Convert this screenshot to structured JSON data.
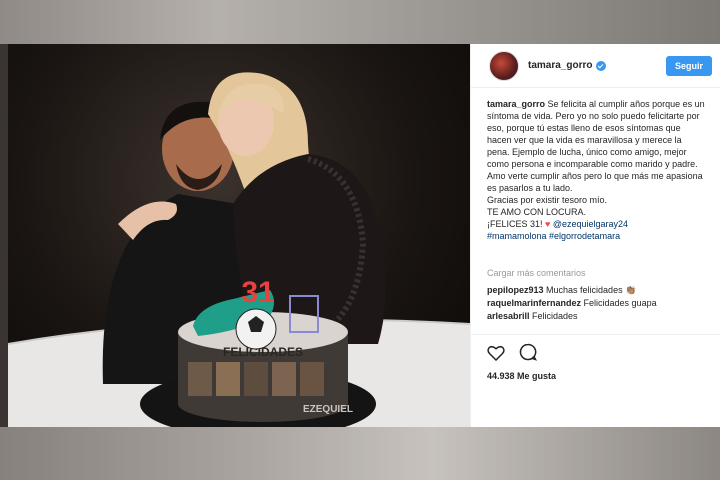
{
  "post": {
    "username": "tamara_gorro",
    "follow_label": "Seguir",
    "caption_author": "tamara_gorro",
    "caption_text": " Se felicita al cumplir años porque es un síntoma de vida. Pero yo no solo puedo felicitarte por eso, porque tú estas lleno de esos síntomas que hacen ver que la vida es maravillosa y merece la pena. Ejemplo de lucha, único como amigo, mejor como persona e incomparable como marido y padre.\nAmo verte cumplir años pero lo que más me apasiona es pasarlos a tu lado.\nGracias por existir tesoro mío.\nTE AMO CON LOCURA.\n¡FELICES 31! ",
    "caption_heart": "♥",
    "caption_mention": " @ezequielgaray24",
    "caption_hashtags": "#mamamolona #elgorrodetamara",
    "load_more": "Cargar más comentarios",
    "comments": [
      {
        "user": "pepilopez913",
        "text": " Muchas felicidades 👏🏽"
      },
      {
        "user": "raquelmarinfernandez",
        "text": " Felicidades guapa"
      },
      {
        "user": "arlesabrill",
        "text": " Felicidades"
      }
    ],
    "likes": "44.938 Me gusta",
    "icons": {
      "like": "heart-outline-icon",
      "comment": "comment-bubble-icon",
      "verified": "verified-badge-icon"
    },
    "colors": {
      "accent": "#3897f0",
      "text": "#262626",
      "muted": "#999999",
      "link": "#003569"
    }
  },
  "photo": {
    "cake_topper": "31",
    "cake_text": "FELICIDADES",
    "cake_base_text": "EZEQUIEL"
  }
}
